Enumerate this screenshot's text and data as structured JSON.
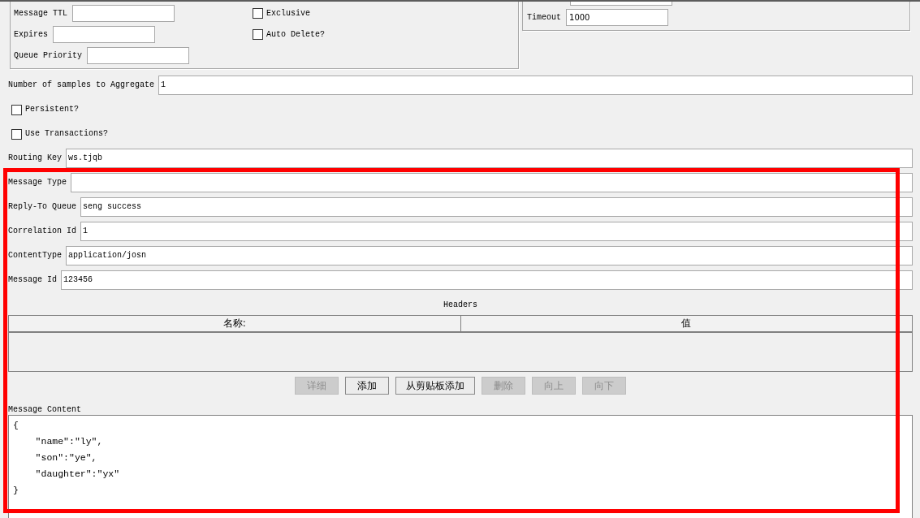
{
  "queue_options": {
    "fields": [
      {
        "label": "Message TTL"
      },
      {
        "label": "Expires"
      },
      {
        "label": "Queue Priority"
      }
    ],
    "checkboxes": [
      {
        "label": "Exclusive",
        "checked": false
      },
      {
        "label": "Auto Delete?",
        "checked": false
      }
    ]
  },
  "connection_options": {
    "fields": [
      {
        "label": "Timeout",
        "value": "1000"
      }
    ]
  },
  "form_rows": [
    {
      "kind": "text",
      "label": "Number of samples to Aggregate",
      "value": "1"
    },
    {
      "kind": "checkbox",
      "label": "Persistent?",
      "checked": false
    },
    {
      "kind": "checkbox",
      "label": "Use Transactions?",
      "checked": false
    },
    {
      "kind": "text",
      "label": "Routing Key",
      "value": "ws.tjqb"
    },
    {
      "kind": "text",
      "label": "Message Type"
    },
    {
      "kind": "text",
      "label": "Reply-To Queue",
      "value": "seng success"
    },
    {
      "kind": "text",
      "label": "Correlation Id",
      "value": "1"
    },
    {
      "kind": "text",
      "label": "ContentType",
      "value": "application/josn"
    },
    {
      "kind": "text",
      "label": "Message Id",
      "value": "123456"
    }
  ],
  "headers": {
    "title": "Headers",
    "columns": [
      "名称:",
      "值"
    ]
  },
  "header_buttons": [
    {
      "label": "详细",
      "disabled": true
    },
    {
      "label": "添加",
      "disabled": false
    },
    {
      "label": "从剪贴板添加",
      "disabled": false
    },
    {
      "label": "删除",
      "disabled": true
    },
    {
      "label": "向上",
      "disabled": true
    },
    {
      "label": "向下",
      "disabled": true
    }
  ],
  "message_content": {
    "label": "Message Content",
    "value": "{\n    \"name\":\"ly\",\n    \"son\":\"ye\",\n    \"daughter\":\"yx\"\n}"
  }
}
